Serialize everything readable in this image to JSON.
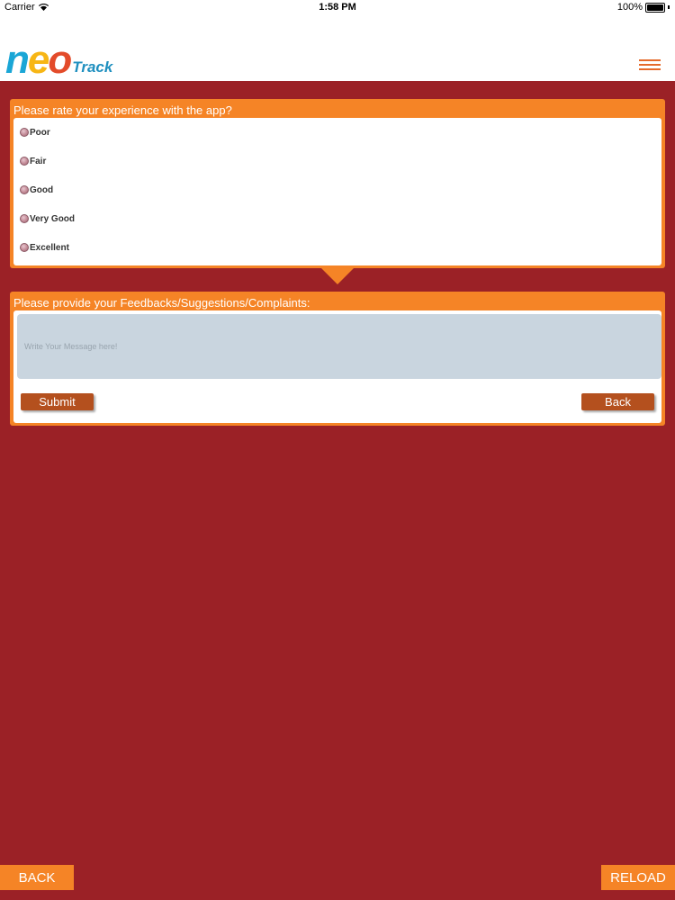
{
  "status_bar": {
    "carrier": "Carrier",
    "time": "1:58 PM",
    "battery": "100%"
  },
  "header": {
    "logo_neo": "neo",
    "logo_track": "Track",
    "menu_icon": "hamburger-menu-icon"
  },
  "rating": {
    "title": "Please rate your experience with the app?",
    "options": [
      "Poor",
      "Fair",
      "Good",
      "Very Good",
      "Excellent"
    ]
  },
  "feedback": {
    "title": "Please provide your Feedbacks/Suggestions/Complaints:",
    "placeholder": "Write Your Message here!",
    "value": "",
    "submit_label": "Submit",
    "back_label": "Back"
  },
  "footer": {
    "back_label": "BACK",
    "reload_label": "RELOAD"
  },
  "colors": {
    "background": "#9b2126",
    "accent": "#f58426",
    "button": "#b4501e",
    "input": "#c9d5df"
  }
}
